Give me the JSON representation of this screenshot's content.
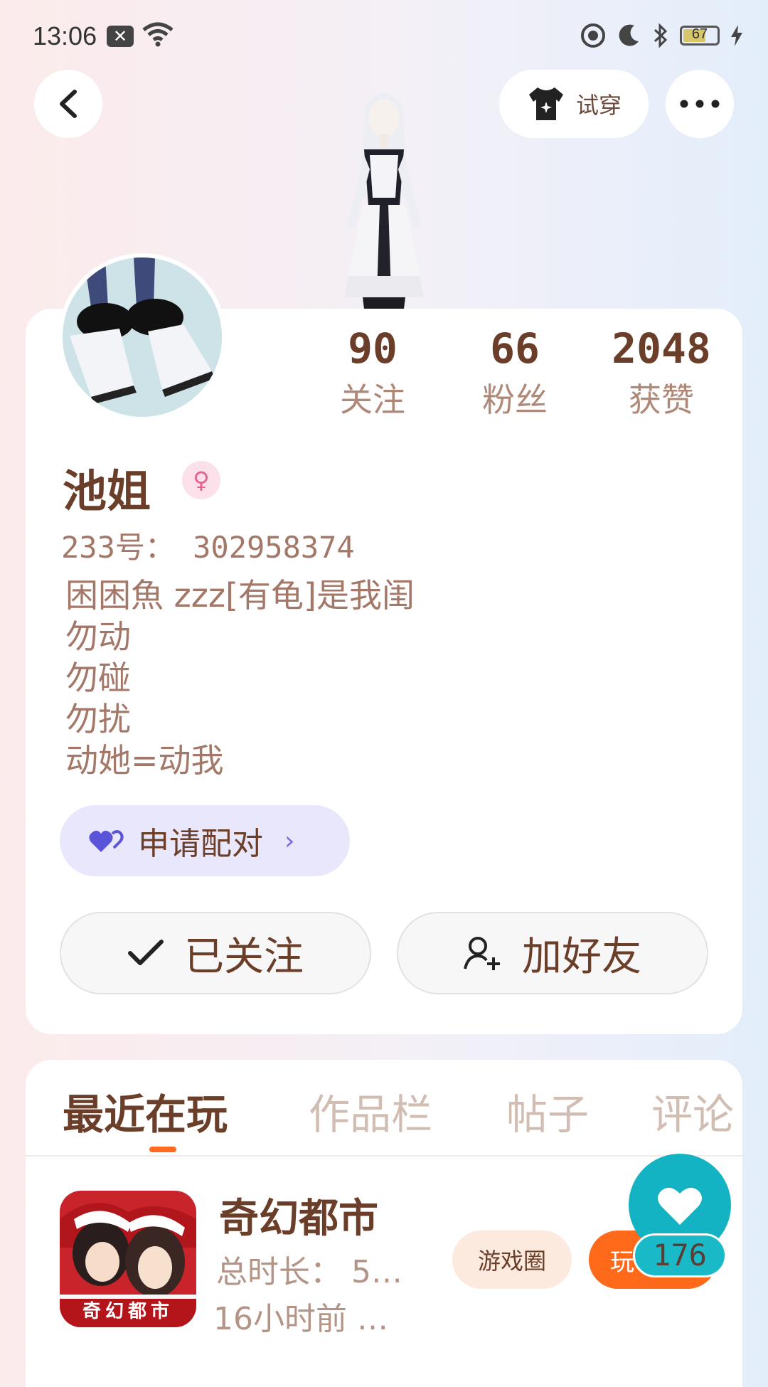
{
  "status_bar": {
    "time": "13:06",
    "battery": "67"
  },
  "header": {
    "try_on_label": "试穿"
  },
  "stats": [
    {
      "value": "90",
      "label": "关注"
    },
    {
      "value": "66",
      "label": "粉丝"
    },
    {
      "value": "2048",
      "label": "获赞"
    }
  ],
  "profile": {
    "name": "池姐",
    "gender_symbol": "♀",
    "uid": "233号： 302958374",
    "bio": "困困魚 zzz[有龟]是我闺\n勿动\n勿碰\n勿扰\n动她=动我"
  },
  "pair_button": {
    "label": "申请配对"
  },
  "actions": {
    "follow_label": "已关注",
    "add_friend_label": "加好友"
  },
  "tabs": [
    {
      "label": "最近在玩"
    },
    {
      "label": "作品栏"
    },
    {
      "label": "帖子"
    },
    {
      "label": "评论"
    }
  ],
  "recent_game": {
    "title": "奇幻都市",
    "icon_caption": "奇幻都市",
    "total_time": "总时长： 5…",
    "last_played": "16小时前 …",
    "circle_label": "游戏圈",
    "play_label": "玩"
  },
  "likes": {
    "count": "176"
  },
  "colors": {
    "accent": "#ff6a1a",
    "brand_teal": "#14b3c3",
    "text_brown": "#6b3e2a",
    "pair_bg": "#e8e7fb"
  }
}
